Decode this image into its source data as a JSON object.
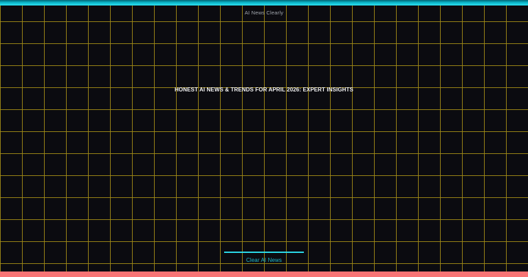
{
  "page": {
    "site_title": "AI News Clearly",
    "heading": "HONEST AI NEWS & TRENDS FOR APRIL 2026: EXPERT INSIGHTS",
    "footer": {
      "brand": "Clear AI News"
    }
  },
  "theme": {
    "background": "#0b0b10",
    "grid_line_color": "#9e8816",
    "grid_cell_size_px": 32,
    "top_bar_gradient": [
      "#026575",
      "#2ee2f2"
    ],
    "bottom_bar_color": "#f87474",
    "divider_color": "#2bd8e8",
    "brand_text_color": "#1db8cc",
    "heading_color": "#f2f2f2",
    "site_title_color": "#a3a8af"
  }
}
